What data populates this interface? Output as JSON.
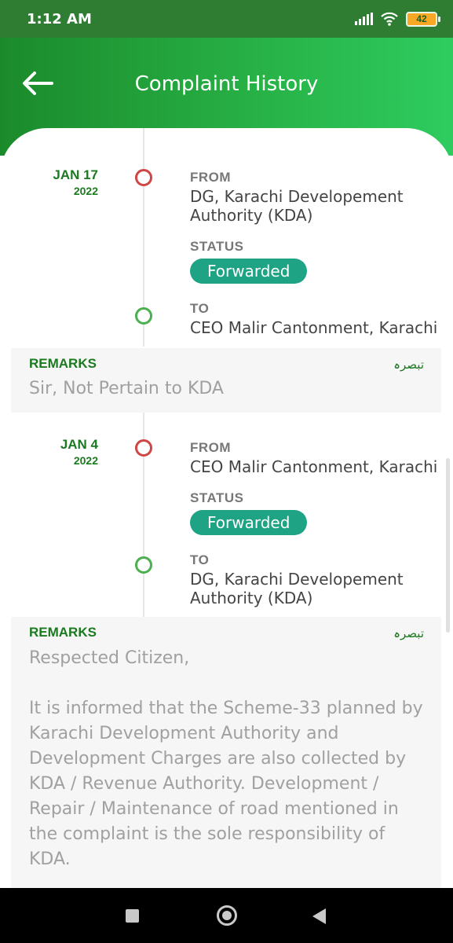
{
  "status_bar": {
    "time": "1:12 AM",
    "battery": "42",
    "icons": [
      "signal-icon",
      "wifi-icon",
      "battery-icon"
    ]
  },
  "header": {
    "title": "Complaint History",
    "back_icon": "back-arrow-icon"
  },
  "colors": {
    "header_start": "#1b8a2b",
    "header_end": "#2ecc5f",
    "date_green": "#1b7a20",
    "status_badge": "#1fa385",
    "dot_from": "#d04545",
    "dot_to": "#4caf50"
  },
  "entries": [
    {
      "date": "JAN 17",
      "year": "2022",
      "from_label": "FROM",
      "from_value": "DG, Karachi Developement Authority (KDA)",
      "status_label": "STATUS",
      "status_value": "Forwarded",
      "to_label": "TO",
      "to_value": "CEO Malir Cantonment, Karachi",
      "remarks_title": "REMARKS",
      "remarks_urdu": "تبصرہ",
      "remarks_text": "Sir, Not Pertain to KDA"
    },
    {
      "date": "JAN 4",
      "year": "2022",
      "from_label": "FROM",
      "from_value": "CEO Malir Cantonment, Karachi",
      "status_label": "STATUS",
      "status_value": "Forwarded",
      "to_label": "TO",
      "to_value": "DG, Karachi Developement Authority (KDA)",
      "remarks_title": "REMARKS",
      "remarks_urdu": "تبصرہ",
      "remarks_text": "Respected Citizen,\n\nIt is informed that the Scheme-33 planned by Karachi Development Authority and Development Charges are also collected by KDA / Revenue Authority. Development / Repair / Maintenance of road mentioned in the complaint is the sole responsibility of KDA.\n\nYour complaint has been forwarded to the"
    }
  ],
  "nav_bar": {
    "icons": [
      "recents-icon",
      "home-icon",
      "back-icon"
    ]
  }
}
